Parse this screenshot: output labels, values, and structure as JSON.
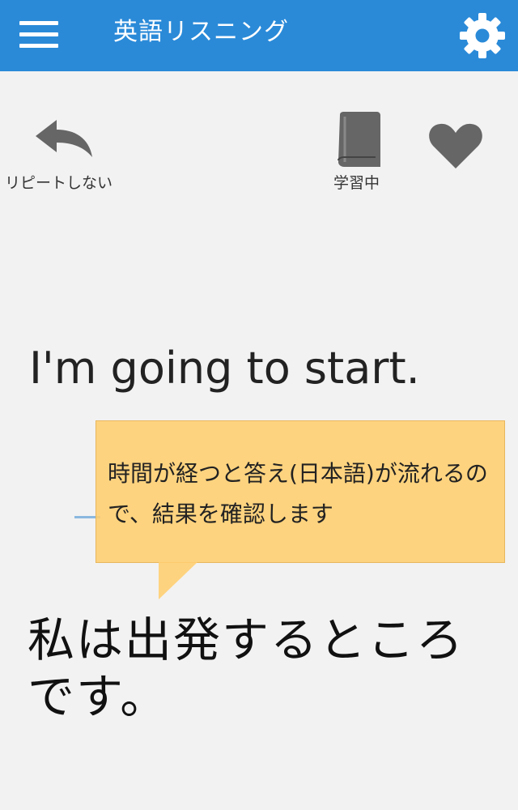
{
  "app": {
    "title": "英語リスニング",
    "menu_icon": "hamburger-menu-icon",
    "settings_icon": "gear-icon",
    "accent_color": "#2a8ad8"
  },
  "toolbar": {
    "repeat": {
      "icon": "undo-arrow-icon",
      "label": "リピートしない"
    },
    "study": {
      "icon": "book-icon",
      "label": "学習中"
    },
    "favorite": {
      "icon": "heart-icon",
      "label": ""
    }
  },
  "content": {
    "english": "I'm going to start.",
    "japanese": "私は出発するところです。"
  },
  "tooltip": {
    "text": "時間が経つと答え(日本語)が流れるので、結果を確認します",
    "background_color": "#ffce6e"
  }
}
